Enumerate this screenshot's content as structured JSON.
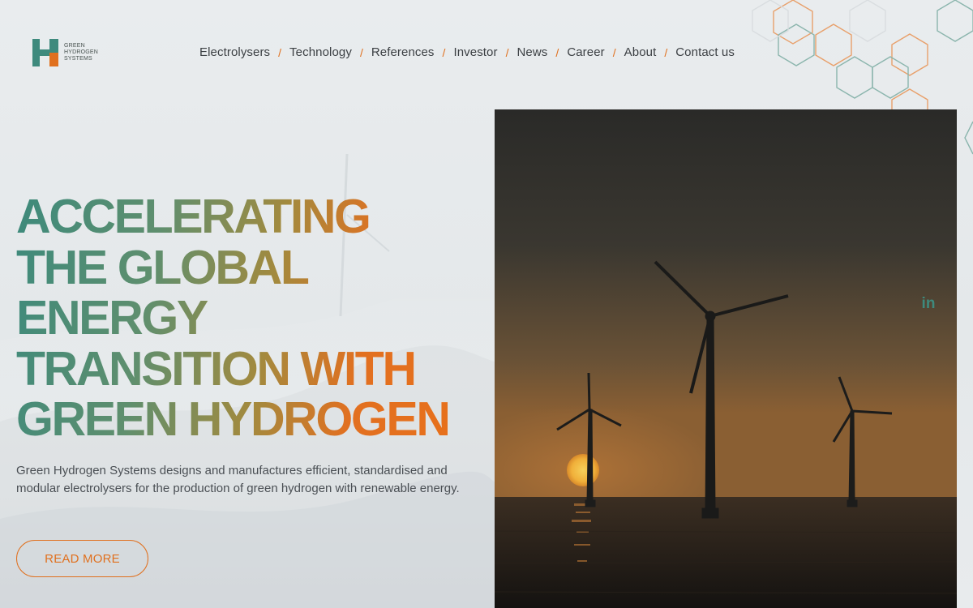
{
  "brand": {
    "logo_text": "GREEN HYDROGEN SYSTEMS",
    "colors": {
      "green": "#3e8a7d",
      "orange": "#e0701e"
    }
  },
  "nav": {
    "items": [
      {
        "label": "Electrolysers"
      },
      {
        "label": "Technology"
      },
      {
        "label": "References"
      },
      {
        "label": "Investor"
      },
      {
        "label": "News"
      },
      {
        "label": "Career"
      },
      {
        "label": "About"
      },
      {
        "label": "Contact us"
      }
    ],
    "separator": "/"
  },
  "hero": {
    "title_lines": [
      "ACCELERATING",
      "THE GLOBAL",
      "ENERGY",
      "TRANSITION WITH",
      "GREEN HYDROGEN"
    ],
    "description": "Green Hydrogen Systems designs and manufactures efficient, standardised and modular electrolysers for the production of green hydrogen with renewable energy.",
    "cta_label": "READ MORE",
    "image_subject": "offshore wind turbines at sunset"
  },
  "social": {
    "linkedin_label": "in"
  }
}
